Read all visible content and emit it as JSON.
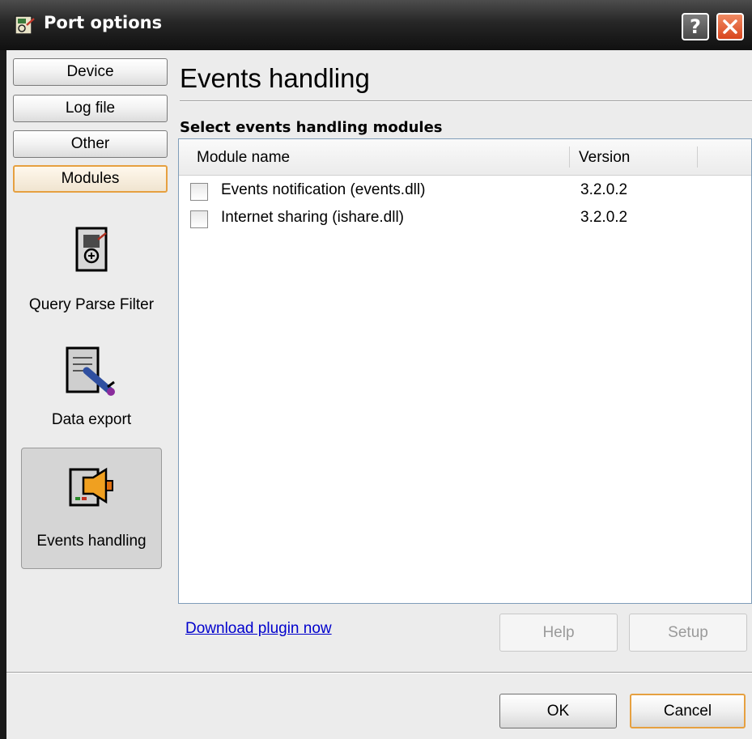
{
  "window": {
    "title": "Port options",
    "help_glyph": "?",
    "close_glyph": "✕"
  },
  "nav": {
    "items": [
      {
        "label": "Device",
        "active": false
      },
      {
        "label": "Log file",
        "active": false
      },
      {
        "label": "Other",
        "active": false
      },
      {
        "label": "Modules",
        "active": true
      }
    ]
  },
  "modules": {
    "items": [
      {
        "label": "Query Parse Filter",
        "icon": "query-parse-filter-icon"
      },
      {
        "label": "Data export",
        "icon": "data-export-icon"
      },
      {
        "label": "Events handling",
        "icon": "events-handling-icon",
        "selected": true
      }
    ]
  },
  "main": {
    "heading": "Events handling",
    "subheading": "Select events handling modules",
    "columns": [
      "Module name",
      "Version"
    ],
    "rows": [
      {
        "name": "Events notification (events.dll)",
        "version": "3.2.0.2",
        "checked": false
      },
      {
        "name": "Internet sharing (ishare.dll)",
        "version": "3.2.0.2",
        "checked": false
      }
    ],
    "download_link": "Download plugin now",
    "help_label": "Help",
    "setup_label": "Setup"
  },
  "footer": {
    "ok_label": "OK",
    "cancel_label": "Cancel"
  },
  "colors": {
    "active_border": "#e6a040",
    "title_bar": "#262626",
    "close_button": "#d8461f",
    "link": "#0000cc"
  }
}
